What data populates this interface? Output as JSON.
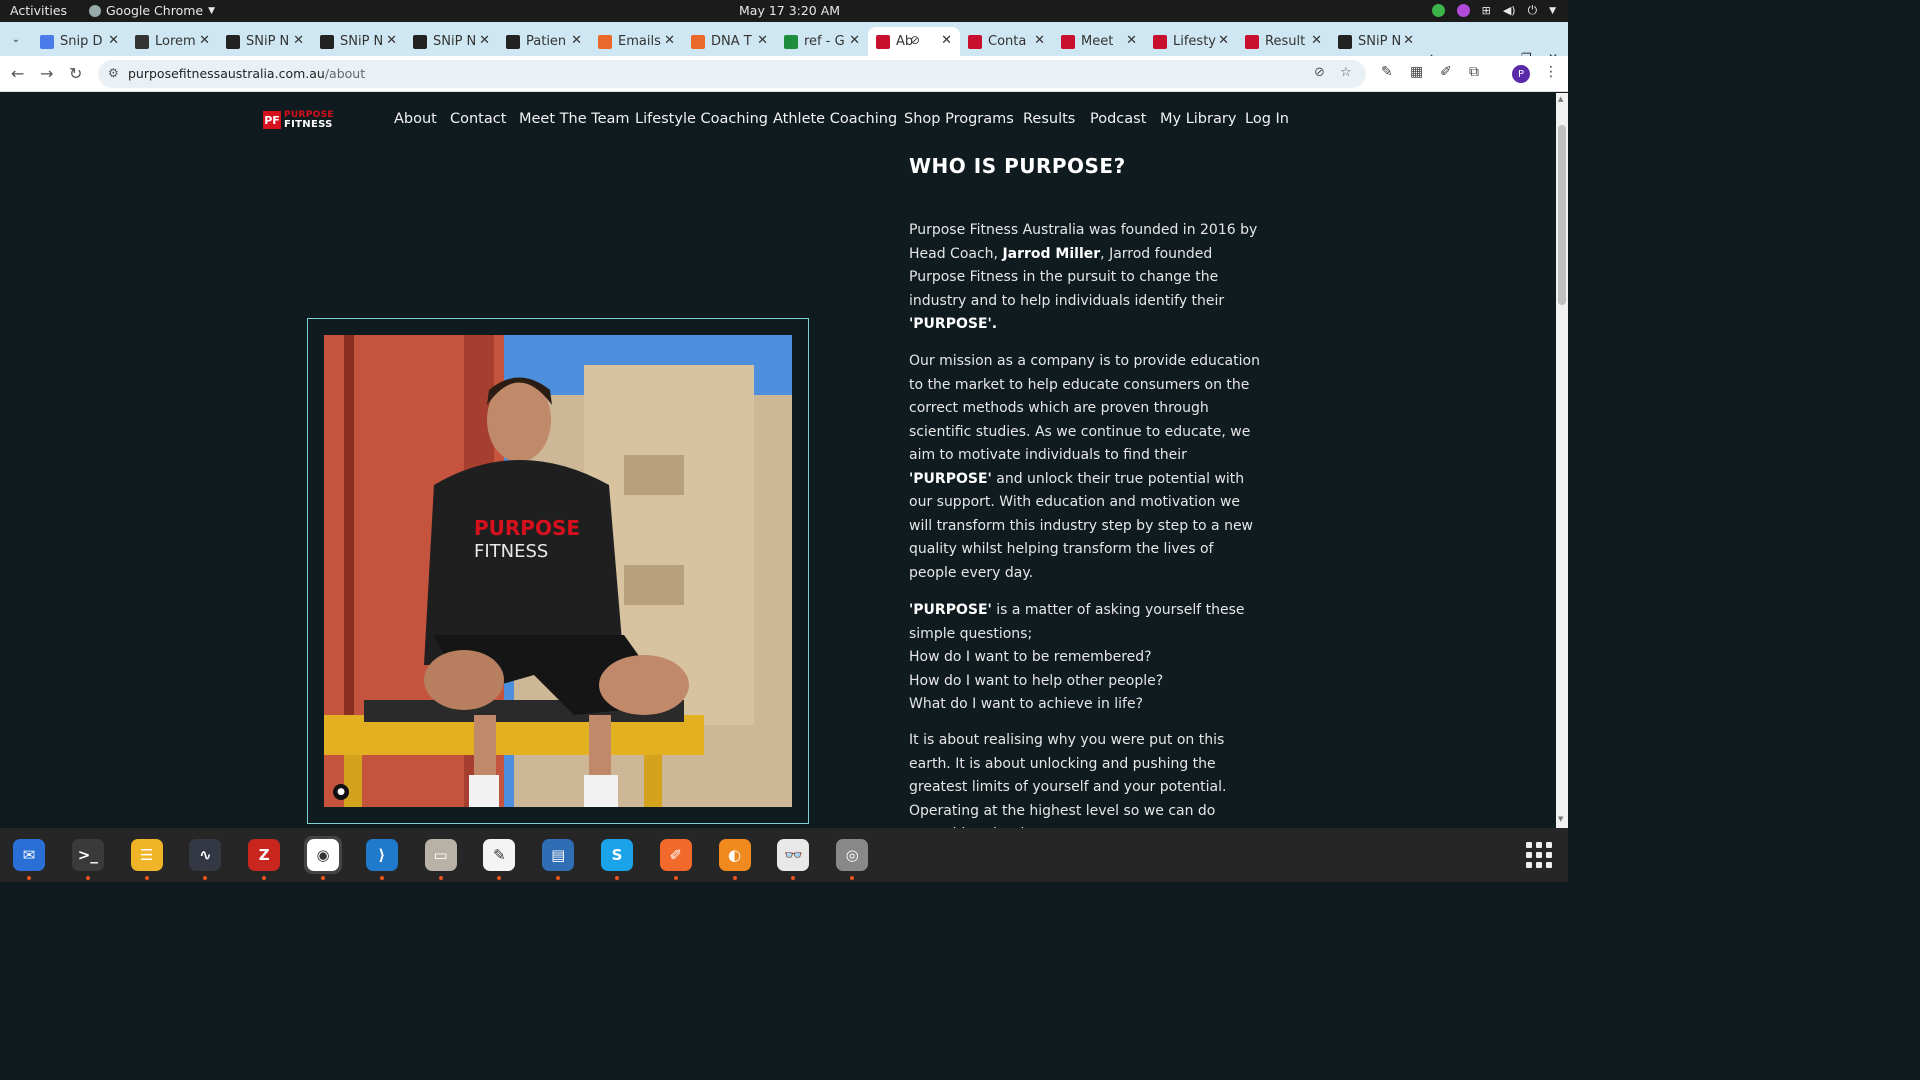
{
  "topbar": {
    "activities": "Activities",
    "app_name": "Google Chrome",
    "clock": "May 17  3:20 AM"
  },
  "tabs": [
    {
      "title": "Snip D",
      "icon": "docs-icon",
      "color": "#4a7be8"
    },
    {
      "title": "Lorem",
      "icon": "lorem-l-icon",
      "color": "#333333"
    },
    {
      "title": "SNiP N",
      "icon": "snip-icon",
      "color": "#222222"
    },
    {
      "title": "SNiP N",
      "icon": "snip-icon",
      "color": "#222222"
    },
    {
      "title": "SNiP N",
      "icon": "snip-icon",
      "color": "#222222"
    },
    {
      "title": "Patien",
      "icon": "snip-icon",
      "color": "#222222"
    },
    {
      "title": "Emails",
      "icon": "emails-icon",
      "color": "#e9682a"
    },
    {
      "title": "DNA T",
      "icon": "dna-icon",
      "color": "#e9682a"
    },
    {
      "title": "ref - G",
      "icon": "sheets-icon",
      "color": "#1e8e3e"
    },
    {
      "title": "Ab",
      "icon": "purpose-icon",
      "color": "#c8102e",
      "active": true
    },
    {
      "title": "Conta",
      "icon": "purpose-icon",
      "color": "#c8102e"
    },
    {
      "title": "Meet",
      "icon": "purpose-icon",
      "color": "#c8102e"
    },
    {
      "title": "Lifesty",
      "icon": "purpose-icon",
      "color": "#c8102e"
    },
    {
      "title": "Result",
      "icon": "purpose-icon",
      "color": "#c8102e"
    },
    {
      "title": "SNiP N",
      "icon": "snip-icon",
      "color": "#222222"
    }
  ],
  "omnibox": {
    "domain": "purposefitnessaustralia.com.au",
    "path": "/about"
  },
  "profile_initial": "P",
  "site": {
    "logo_line1": "PURPOSE",
    "logo_line2": "FITNESS",
    "nav": [
      "About",
      "Contact",
      "Meet The Team",
      "Lifestyle Coaching",
      "Athlete Coaching",
      "Shop Programs",
      "Results",
      "Podcast",
      "My Library",
      "Log In"
    ],
    "heading": "WHO IS PURPOSE?",
    "p1_a": "Purpose Fitness Australia was founded in 2016 by Head Coach, ",
    "p1_name": "Jarrod Miller",
    "p1_b": ", Jarrod founded Purpose Fitness in the pursuit to change the industry and to help individuals identify their ",
    "p1_purpose": "'PURPOSE'.",
    "p2_a": "Our mission as a company is to provide education to the market to help educate consumers on the correct methods which are proven through scientific studies. As we continue to educate, we aim to motivate individuals to find their ",
    "p2_purpose": "'PURPOSE'",
    "p2_b": " and unlock their true potential with our support. With education and motivation we will transform this industry step by step to a new quality whilst helping transform the lives of people every day.",
    "p3_purpose": "'PURPOSE'",
    "p3_a": " is a matter of asking yourself these simple questions;",
    "q1": "How do I want to be remembered?",
    "q2": "How do I want to help other people?",
    "q3": "What do I want to achieve in life?",
    "p4": "It is about realising why you were put on this earth. It is about unlocking and pushing the greatest limits of yourself and your potential. Operating at the highest level so we can do something that has"
  },
  "accent": "#7ad4d4",
  "brand_red": "#d6101d",
  "dock": [
    "thunderbird-icon",
    "terminal-icon",
    "notes-icon",
    "system-monitor-icon",
    "filezilla-icon",
    "chrome-icon",
    "vscode-icon",
    "files-icon",
    "text-editor-icon",
    "document-viewer-icon",
    "skype-icon",
    "postman-icon",
    "burn-icon",
    "screen-reader-icon",
    "disk-icon"
  ]
}
